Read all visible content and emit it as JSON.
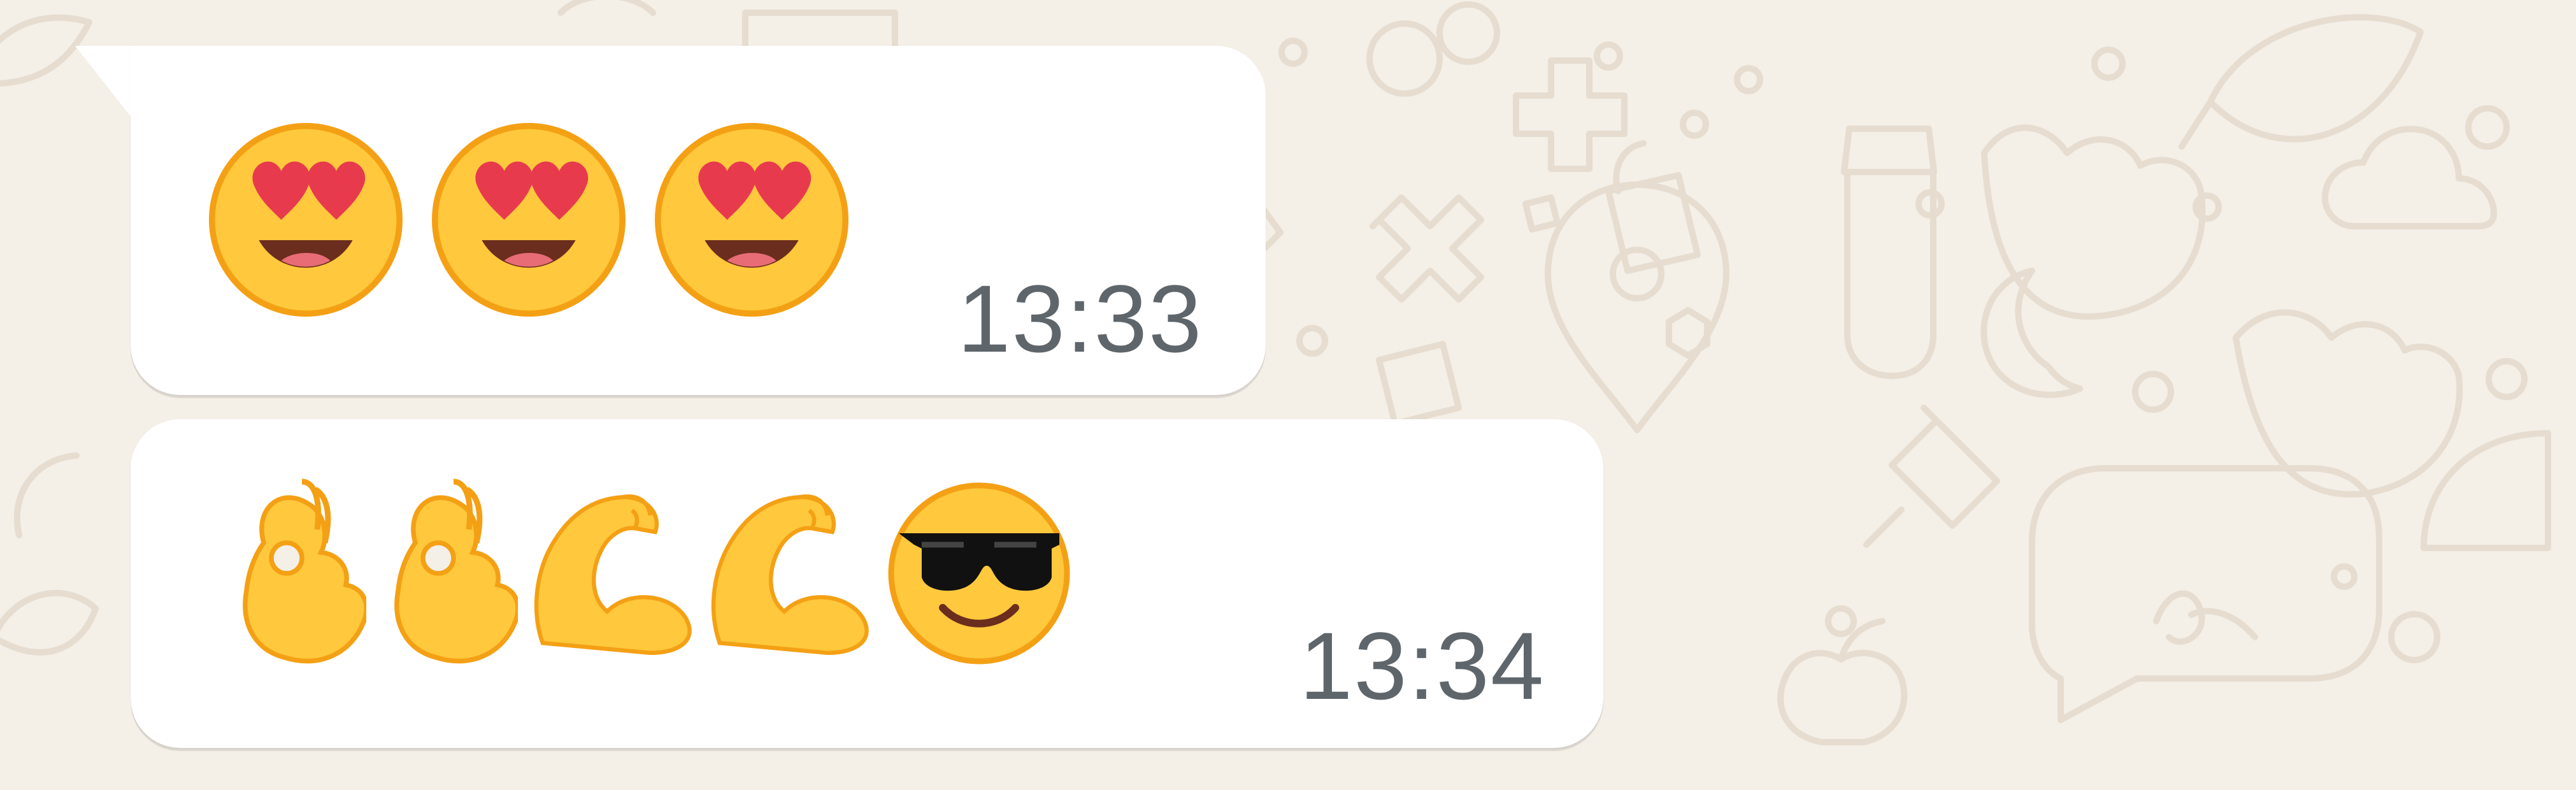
{
  "chat": {
    "messages": [
      {
        "emojis": [
          {
            "name": "heart-eyes-emoji-icon",
            "glyph": "😍"
          },
          {
            "name": "heart-eyes-emoji-icon",
            "glyph": "😍"
          },
          {
            "name": "heart-eyes-emoji-icon",
            "glyph": "😍"
          }
        ],
        "time": "13:33"
      },
      {
        "emojis": [
          {
            "name": "ok-hand-emoji-icon",
            "glyph": "👌"
          },
          {
            "name": "ok-hand-emoji-icon",
            "glyph": "👌"
          },
          {
            "name": "flexed-biceps-emoji-icon",
            "glyph": "💪"
          },
          {
            "name": "flexed-biceps-emoji-icon",
            "glyph": "💪"
          },
          {
            "name": "sunglasses-emoji-icon",
            "glyph": "😎"
          }
        ],
        "time": "13:34"
      }
    ]
  },
  "colors": {
    "wallpaper": "#f4efe7",
    "bubble": "#ffffff",
    "timestamp": "#5f666b",
    "emoji_yellow": "#ffc83d",
    "emoji_orange": "#f4a015",
    "heart_red": "#e83a4d"
  }
}
